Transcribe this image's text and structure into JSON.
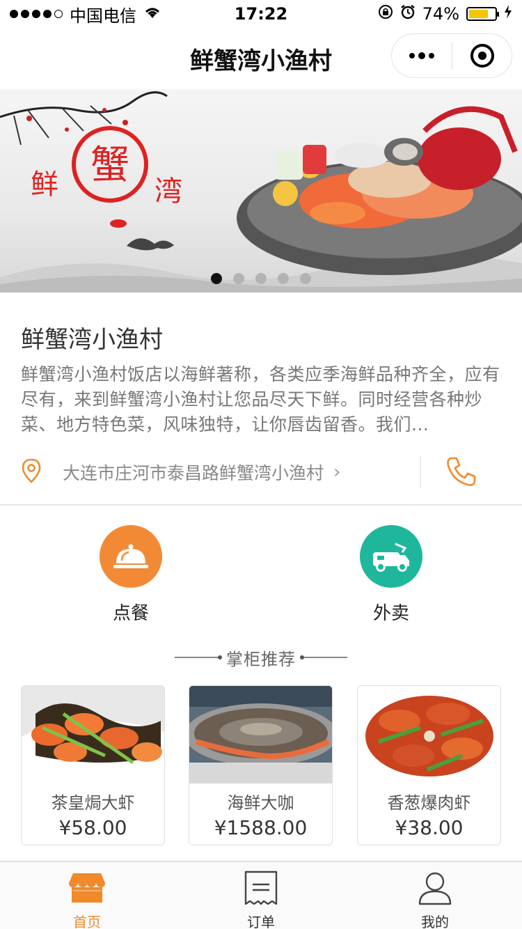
{
  "status_bar": {
    "carrier": "中国电信",
    "time": "17:22",
    "battery_percent": "74%",
    "battery_level": 0.74,
    "icons": [
      "signal-icon",
      "wifi-icon",
      "orientation-lock-icon",
      "alarm-icon",
      "battery-icon",
      "charging-icon"
    ]
  },
  "nav": {
    "title": "鲜蟹湾小渔村",
    "more_icon": "more-dots-icon",
    "close_icon": "target-close-icon"
  },
  "banner": {
    "seal_text": "蟹",
    "left_text": "鲜",
    "right_text": "湾",
    "slide_count": 5,
    "active_slide": 1
  },
  "shop": {
    "name": "鲜蟹湾小渔村",
    "description": "鲜蟹湾小渔村饭店以海鲜著称，各类应季海鲜品种齐全，应有尽有，来到鲜蟹湾小渔村让您品尽天下鲜。同时经营各种炒菜、地方特色菜，风味独特，让你唇齿留香。我们...",
    "address": "大连市庄河市泰昌路鲜蟹湾小渔村",
    "arrow": "›"
  },
  "actions": [
    {
      "label": "点餐",
      "icon": "cloche-icon",
      "color": "#f28a35"
    },
    {
      "label": "外卖",
      "icon": "delivery-truck-icon",
      "color": "#1fb79c"
    }
  ],
  "recommend": {
    "title": "掌柜推荐",
    "items": [
      {
        "name": "茶皇焗大虾",
        "price": "¥58.00"
      },
      {
        "name": "海鲜大咖",
        "price": "¥1588.00"
      },
      {
        "name": "香葱爆肉虾",
        "price": "¥38.00"
      }
    ]
  },
  "tab_bar": {
    "active_color": "#f08a2a",
    "tabs": [
      {
        "label": "首页",
        "icon": "store-icon",
        "active": true
      },
      {
        "label": "订单",
        "icon": "receipt-icon",
        "active": false
      },
      {
        "label": "我的",
        "icon": "user-icon",
        "active": false
      }
    ]
  }
}
